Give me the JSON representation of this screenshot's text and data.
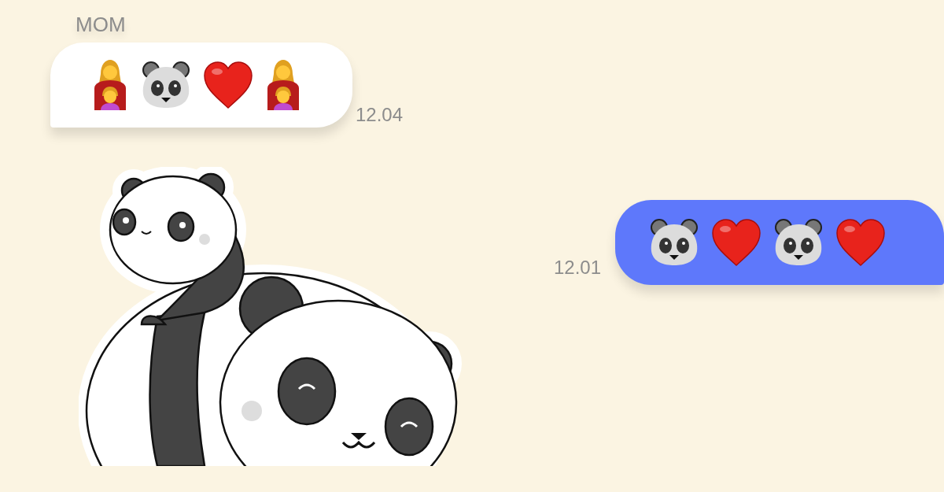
{
  "messages": [
    {
      "kind": "incoming",
      "sender": "MOM",
      "emojis": [
        {
          "kind": "mother-daughter"
        },
        {
          "kind": "panda"
        },
        {
          "kind": "heart"
        },
        {
          "kind": "mother-daughter"
        }
      ],
      "time": "12.04"
    },
    {
      "kind": "outgoing",
      "emojis": [
        {
          "kind": "panda"
        },
        {
          "kind": "heart"
        },
        {
          "kind": "panda"
        },
        {
          "kind": "heart"
        }
      ],
      "time": "12.01"
    }
  ]
}
